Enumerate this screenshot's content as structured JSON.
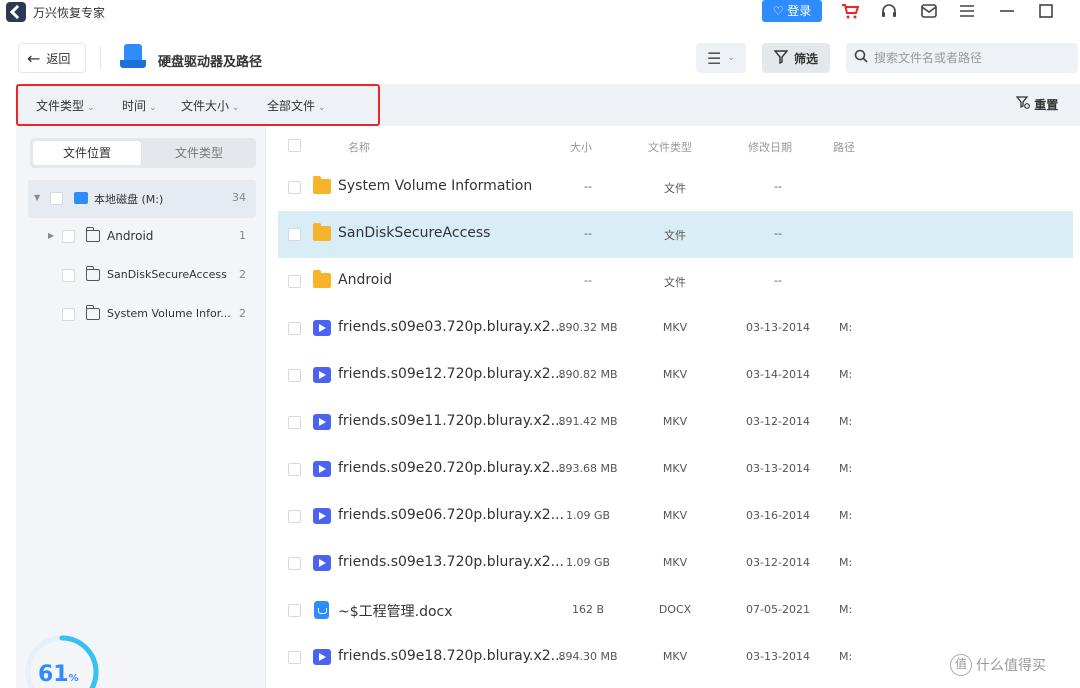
{
  "app": {
    "title": "万兴恢复专家",
    "login_label": "登录"
  },
  "titlebar_icons": [
    "cart-icon",
    "headset-icon",
    "mail-icon",
    "menu-icon",
    "minimize-icon",
    "maximize-icon"
  ],
  "toolbar": {
    "back_label": "返回",
    "page_title": "硬盘驱动器及路径",
    "filter_label": "筛选",
    "search_placeholder": "搜索文件名或者路径"
  },
  "filterbar": {
    "items": [
      "文件类型",
      "时间",
      "文件大小",
      "全部文件"
    ],
    "reset_label": "重置"
  },
  "sidebar": {
    "tabs": [
      "文件位置",
      "文件类型"
    ],
    "tree": [
      {
        "label": "本地磁盘 (M:)",
        "count": "34"
      },
      {
        "label": "Android",
        "count": "1"
      },
      {
        "label": "SanDiskSecureAccess",
        "count": "2"
      },
      {
        "label": "System Volume Infor...",
        "count": "2"
      }
    ],
    "progress": {
      "value": "61",
      "unit": "%",
      "fraction": 0.61
    }
  },
  "table": {
    "headers": [
      "名称",
      "大小",
      "文件类型",
      "修改日期",
      "路径"
    ],
    "rows": [
      {
        "name": "System Volume Information",
        "size": "--",
        "type": "文件",
        "date": "--",
        "path": "",
        "icon": "folder-icon"
      },
      {
        "name": "SanDiskSecureAccess",
        "size": "--",
        "type": "文件",
        "date": "--",
        "path": "",
        "icon": "folder-icon"
      },
      {
        "name": "Android",
        "size": "--",
        "type": "文件",
        "date": "--",
        "path": "",
        "icon": "folder-icon"
      },
      {
        "name": "friends.s09e03.720p.bluray.x2...",
        "size": "890.32 MB",
        "type": "MKV",
        "date": "03-13-2014",
        "path": "M:",
        "icon": "video-icon"
      },
      {
        "name": "friends.s09e12.720p.bluray.x2...",
        "size": "890.82 MB",
        "type": "MKV",
        "date": "03-14-2014",
        "path": "M:",
        "icon": "video-icon"
      },
      {
        "name": "friends.s09e11.720p.bluray.x2...",
        "size": "891.42 MB",
        "type": "MKV",
        "date": "03-12-2014",
        "path": "M:",
        "icon": "video-icon"
      },
      {
        "name": "friends.s09e20.720p.bluray.x2...",
        "size": "893.68 MB",
        "type": "MKV",
        "date": "03-13-2014",
        "path": "M:",
        "icon": "video-icon"
      },
      {
        "name": "friends.s09e06.720p.bluray.x2...",
        "size": "1.09 GB",
        "type": "MKV",
        "date": "03-16-2014",
        "path": "M:",
        "icon": "video-icon"
      },
      {
        "name": "friends.s09e13.720p.bluray.x2...",
        "size": "1.09 GB",
        "type": "MKV",
        "date": "03-12-2014",
        "path": "M:",
        "icon": "video-icon"
      },
      {
        "name": "~$工程管理.docx",
        "size": "162 B",
        "type": "DOCX",
        "date": "07-05-2021",
        "path": "M:",
        "icon": "docx-icon"
      },
      {
        "name": "friends.s09e18.720p.bluray.x2...",
        "size": "894.30 MB",
        "type": "MKV",
        "date": "03-13-2014",
        "path": "M:",
        "icon": "video-icon"
      }
    ]
  },
  "watermark": {
    "text": "什么值得买",
    "logo": "值"
  },
  "colors": {
    "accent": "#2f8cff",
    "highlight_border": "#e8262b",
    "selected_row": "#d9edf6",
    "folder": "#f7b329",
    "video": "#4a63f0"
  }
}
